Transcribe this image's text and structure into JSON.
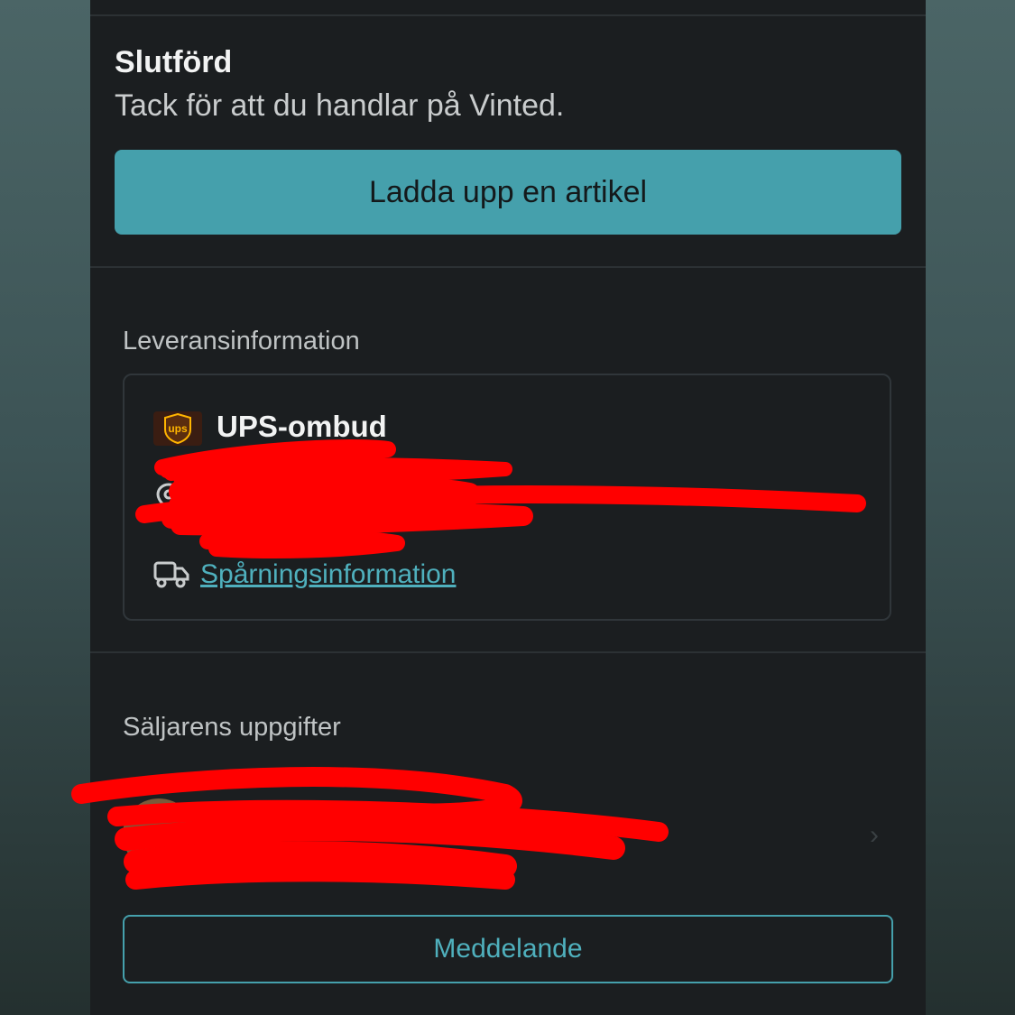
{
  "status": {
    "title": "Slutförd",
    "subtitle": "Tack för att du handlar på Vinted."
  },
  "actions": {
    "upload_label": "Ladda upp en artikel",
    "message_label": "Meddelande"
  },
  "delivery": {
    "heading": "Leveransinformation",
    "carrier_logo_text": "ups",
    "carrier_name": "UPS-ombud",
    "tracking_link": "Spårningsinformation"
  },
  "seller": {
    "heading": "Säljarens uppgifter"
  },
  "colors": {
    "accent": "#45a0ac",
    "background": "#1b1e20",
    "redaction": "#ff0000"
  },
  "icons": {
    "carrier": "ups-logo-icon",
    "location": "location-pin-icon",
    "tracking": "truck-icon",
    "seller_row": "chevron-right-icon"
  }
}
